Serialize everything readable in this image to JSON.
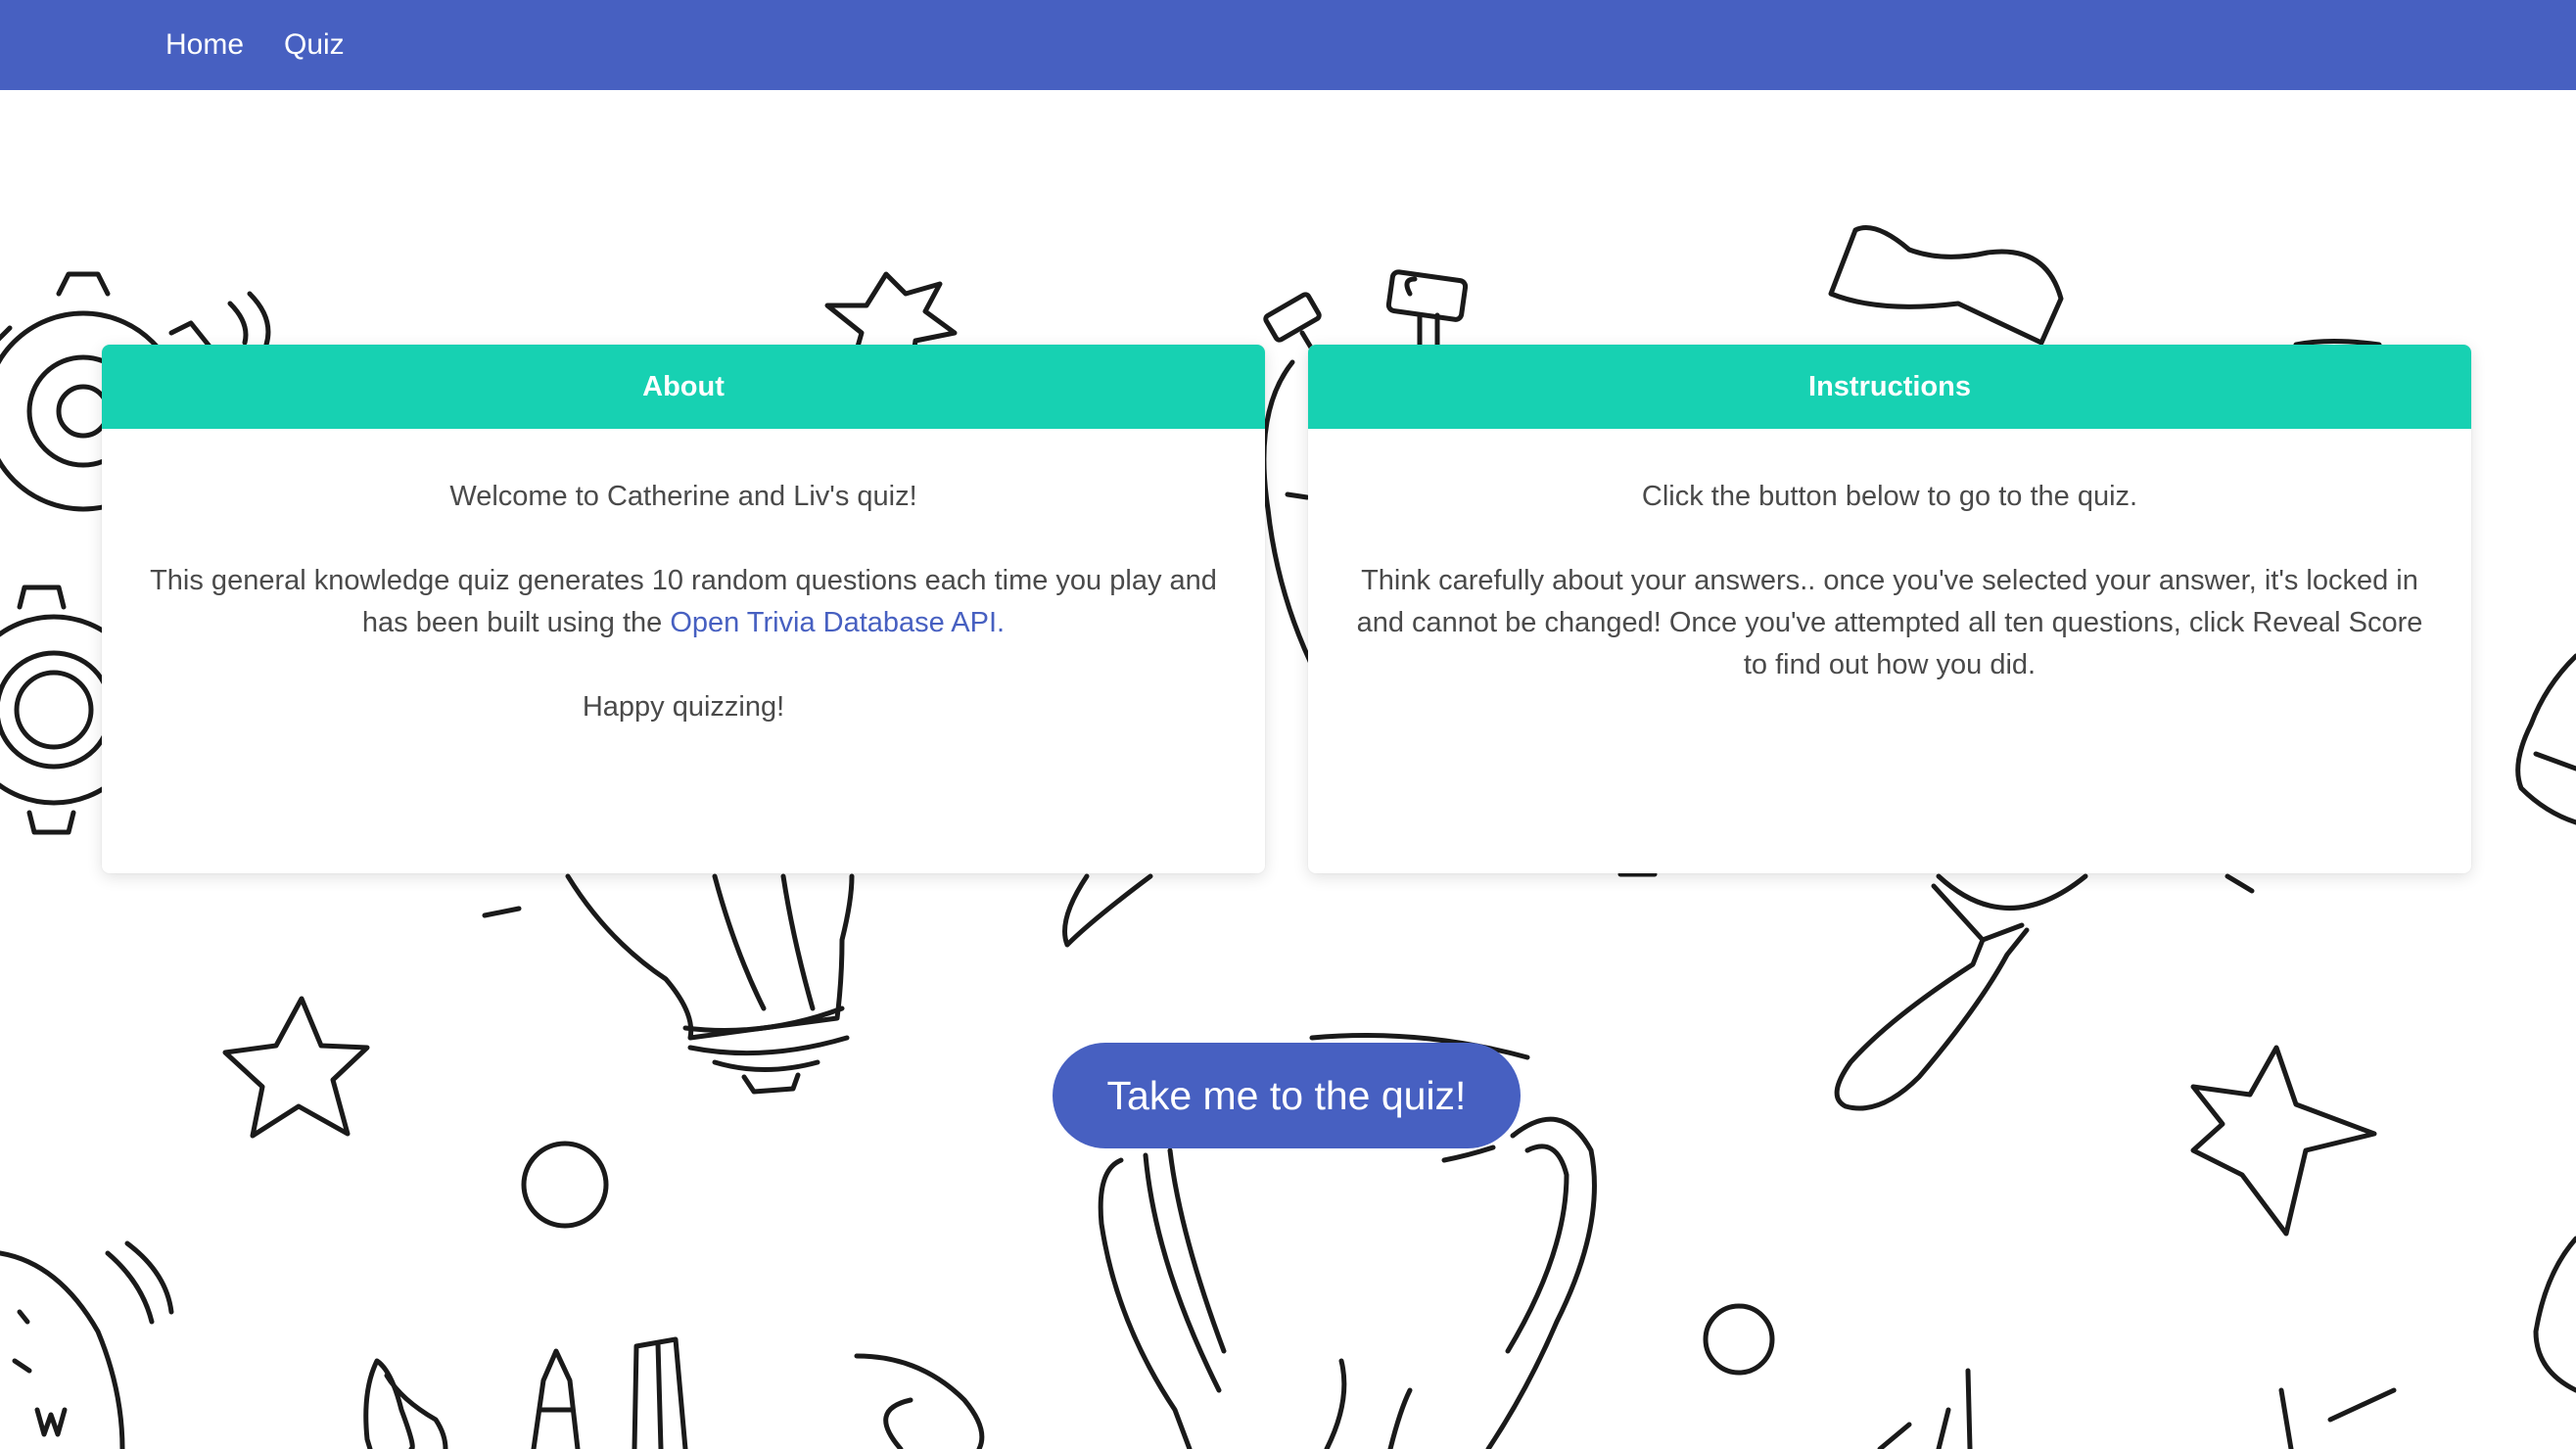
{
  "navbar": {
    "links": [
      {
        "label": "Home"
      },
      {
        "label": "Quiz"
      }
    ]
  },
  "about": {
    "title": "About",
    "welcome": "Welcome to Catherine and Liv's quiz!",
    "description_prefix": "This general knowledge quiz generates 10 random questions each time you play and has been built using the ",
    "link_text": "Open Trivia Database API.",
    "closing": "Happy quizzing!"
  },
  "instructions": {
    "title": "Instructions",
    "line1": "Click the button below to go to the quiz.",
    "line2": "Think carefully about your answers.. once you've selected your answer, it's locked in and cannot be changed! Once you've attempted all ten questions, click Reveal Score to find out how you did."
  },
  "cta": {
    "label": "Take me to the quiz!"
  },
  "colors": {
    "navbar": "#4760c1",
    "card_header": "#17d1b2",
    "button": "#4760c1",
    "link": "#4760c1",
    "text": "#4a4a4a"
  },
  "background_icons": [
    "gear-icon",
    "star-icon",
    "stopwatch-icon",
    "flag-icon",
    "lightbulb-icon",
    "magnifier-icon",
    "trophy-icon",
    "circle-icon",
    "compass-icon",
    "pencil-icon",
    "megaphone-icon"
  ]
}
